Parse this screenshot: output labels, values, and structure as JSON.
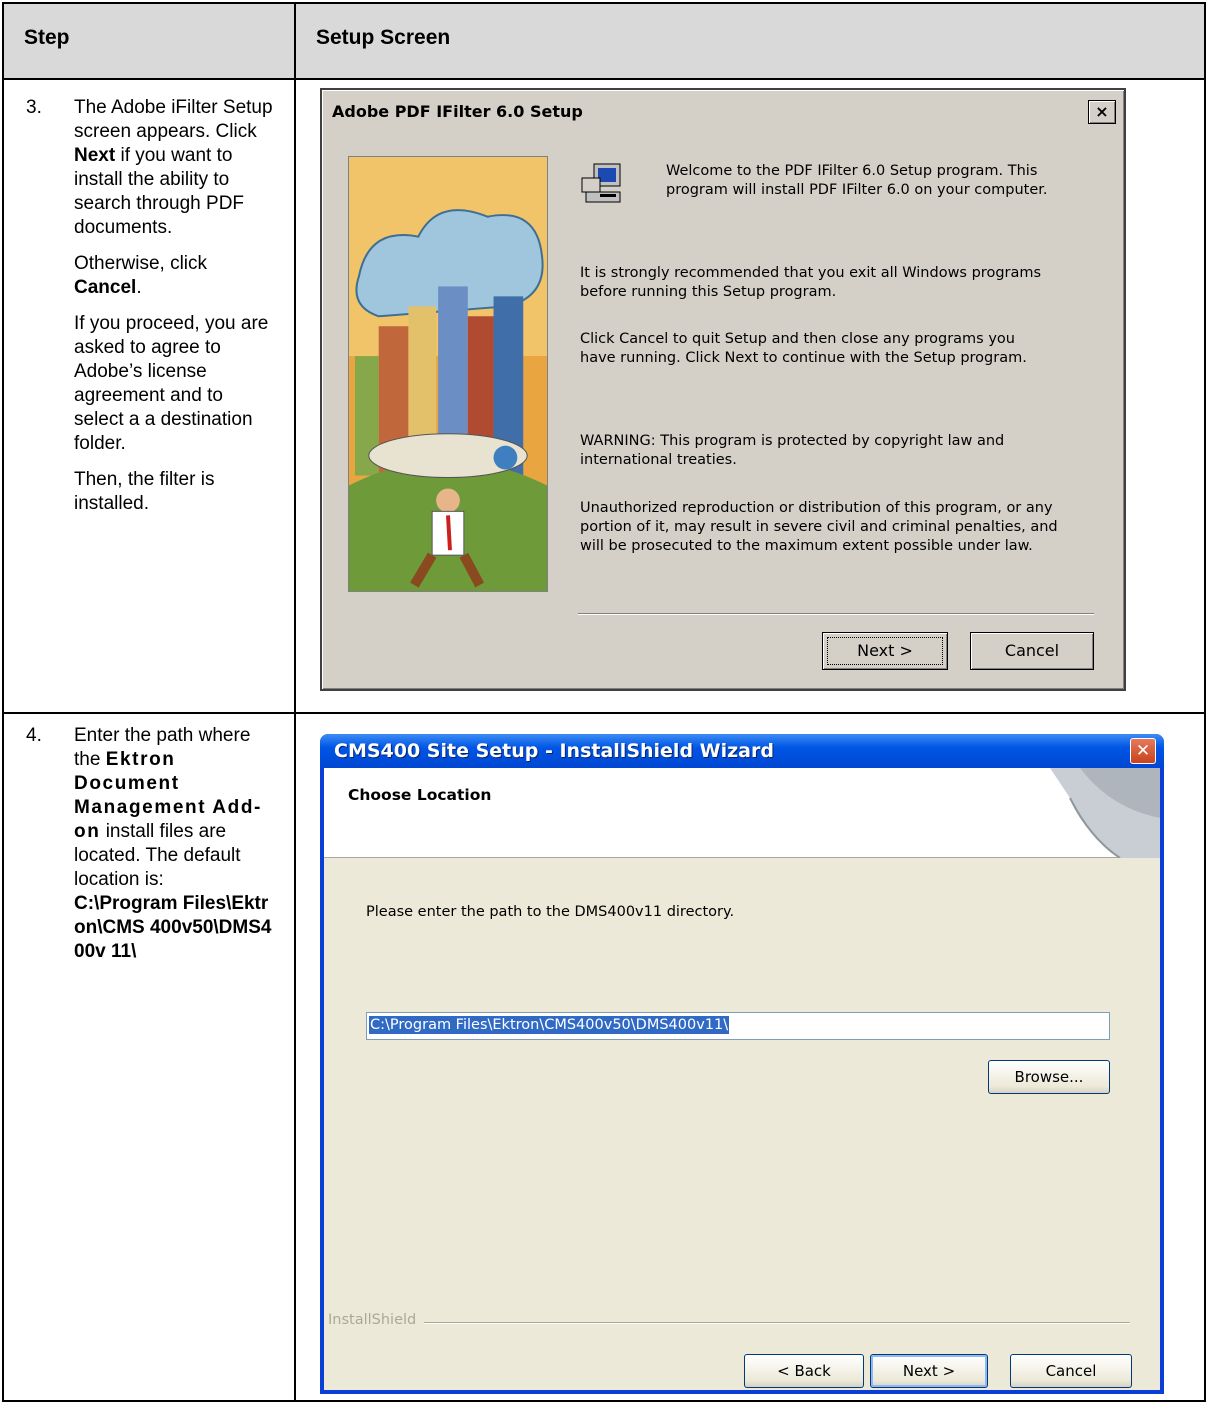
{
  "table": {
    "col_step": "Step",
    "col_screen": "Setup Screen"
  },
  "row3": {
    "num": "3.",
    "p1_pre": "The Adobe iFilter Setup screen appears. Click ",
    "p1_bold": "Next",
    "p1_post": " if you want to install the ability to search through PDF documents.",
    "p2_pre": "Otherwise, click ",
    "p2_bold": "Cancel",
    "p2_post": ".",
    "p3": "If you proceed, you are asked to agree to Adobe’s license agreement and to select a a destination folder.",
    "p4": "Then, the filter is installed."
  },
  "row4": {
    "num": "4.",
    "t_pre": "Enter the path where the ",
    "t_bold": "Ektron Document Management Add-on",
    "t_post": " install files are located. The default location is:",
    "path": "C:\\Program Files\\Ektron\\CMS 400v50\\DMS400v 11\\"
  },
  "dialog1": {
    "title": "Adobe PDF IFilter 6.0 Setup",
    "close": "×",
    "welcome_l1": "Welcome to the PDF IFilter 6.0 Setup program.  This",
    "welcome_l2": "program will install PDF IFilter 6.0 on your computer.",
    "recommend_l1": "It is strongly recommended that you exit all Windows programs",
    "recommend_l2": "before running this Setup program.",
    "cancel_l1": "Click Cancel to quit Setup and then close any programs you",
    "cancel_l2": "have running.  Click Next to continue with the Setup program.",
    "warning_l1": "WARNING: This program is protected by copyright law and",
    "warning_l2": "international treaties.",
    "unauth_l1": "Unauthorized reproduction or distribution of this program, or any",
    "unauth_l2": "portion of it, may result in severe civil and criminal penalties, and",
    "unauth_l3": "will be prosecuted to the maximum extent possible under law.",
    "next": "Next >",
    "cancel": "Cancel"
  },
  "dialog2": {
    "title": "CMS400 Site Setup - InstallShield Wizard",
    "close": "✕",
    "heading": "Choose Location",
    "prompt": "Please enter the path to the DMS400v11 directory.",
    "path_value": "C:\\Program Files\\Ektron\\CMS400v50\\DMS400v11\\",
    "browse": "Browse...",
    "installshield": "InstallShield",
    "back": "< Back",
    "next": "Next >",
    "cancel": "Cancel"
  },
  "colors": {
    "header_bg": "#d9d9d9",
    "win2k_face": "#d4d0c8",
    "xp_blue": "#0055e5",
    "xp_face": "#ece9d8",
    "selection": "#316ac5"
  },
  "icons": [
    "computer-setup-icon",
    "close-icon",
    "adobe-illustration"
  ]
}
